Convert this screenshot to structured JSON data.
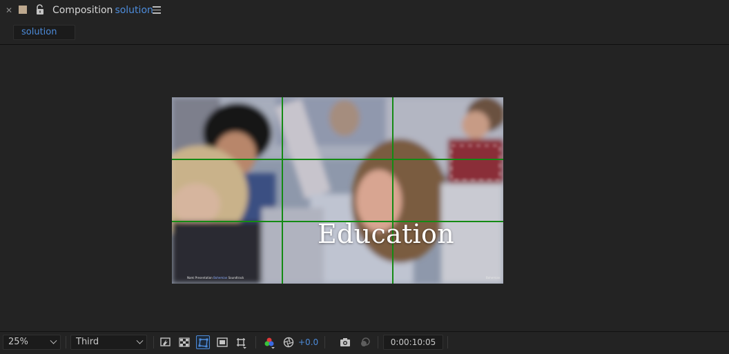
{
  "panel": {
    "title_prefix": "Composition",
    "comp_name": "solution",
    "swatch_color": "#bda88e",
    "lock_icon": "lock-open-icon",
    "menu_icon": "hamburger-menu-icon",
    "close_icon": "close-icon"
  },
  "tabs": [
    {
      "label": "solution",
      "active": true
    }
  ],
  "composition": {
    "title_text": "Education",
    "credit_prefix": "Nami Presentation",
    "credit_highlight": "Bohemian",
    "credit_suffix": "Soundtrack",
    "corner_mark": "Bohemian",
    "guide": "Rule of Thirds grid",
    "guide_color": "#138a13"
  },
  "toolbar": {
    "magnification": "25%",
    "resolution": "Third",
    "exposure": "+0.0",
    "timecode": "0:00:10:05",
    "accent_color": "#4d8cdb",
    "icons": [
      "always-preview-icon",
      "transparency-grid-icon",
      "mask-path-visibility-icon",
      "region-of-interest-icon",
      "grid-guides-icon",
      "channels-rgb-icon",
      "reset-exposure-icon",
      "snapshot-camera-icon",
      "show-snapshot-icon"
    ]
  }
}
